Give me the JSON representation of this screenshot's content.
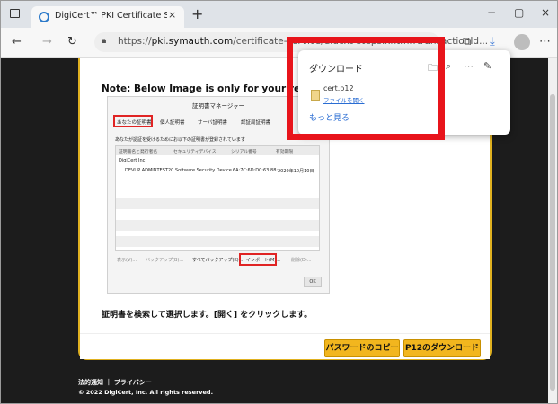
{
  "browser": {
    "tab_title": "DigiCert™ PKI Certificate Service",
    "tab_close": "×",
    "new_tab": "+",
    "window_controls": [
      "−",
      "▢",
      "×"
    ],
    "url_prefix": "https://",
    "url_host": "pki.symauth.com",
    "url_path": "/certificate-service/didc",
    "url_tail": "xt-steps.xhtml?transactionId...",
    "nav": {
      "back": "←",
      "forward": "→",
      "refresh": "↻"
    }
  },
  "downloads": {
    "title": "ダウンロード",
    "file_name": "cert.p12",
    "open_link": "ファイルを開く",
    "more_link": "もっと見る",
    "icons": [
      "folder-icon",
      "search-icon",
      "more-icon",
      "pin-icon"
    ]
  },
  "page": {
    "note": "Note: Below Image is only for your reference. It can vary",
    "cert_manager": {
      "title": "証明書マネージャー",
      "tabs": [
        "あなたの証明書",
        "個人証明書",
        "サーバ証明書",
        "認証局証明書"
      ],
      "description": "あなたが認証を受けるためにお以下の証明書が登録されています",
      "columns": [
        "証明書名と発行者名",
        "セキュリティデバイス",
        "シリアル番号",
        "有効期限"
      ],
      "group": "DigiCert Inc",
      "row": {
        "name": "DEVUP ADMINTEST20...",
        "device": "Software Security Device",
        "serial": "6A:7C:6D:D0:63:88:...",
        "expires": "2020年10月10日"
      },
      "buttons": [
        "表示(V)...",
        "バックアップ(B)...",
        "すべてバックアップ(K)...",
        "インポート(M)...",
        "削除(D)..."
      ],
      "ok": "OK"
    },
    "instruction": "証明書を検索して選択します。[開く] をクリックします。",
    "copy_password_button": "パスワードのコピー",
    "download_p12_button": "P12のダウンロード",
    "footer_links": "法的通知 ｜ プライバシー",
    "copyright": "© 2022 DigiCert, Inc. All rights reserved."
  }
}
